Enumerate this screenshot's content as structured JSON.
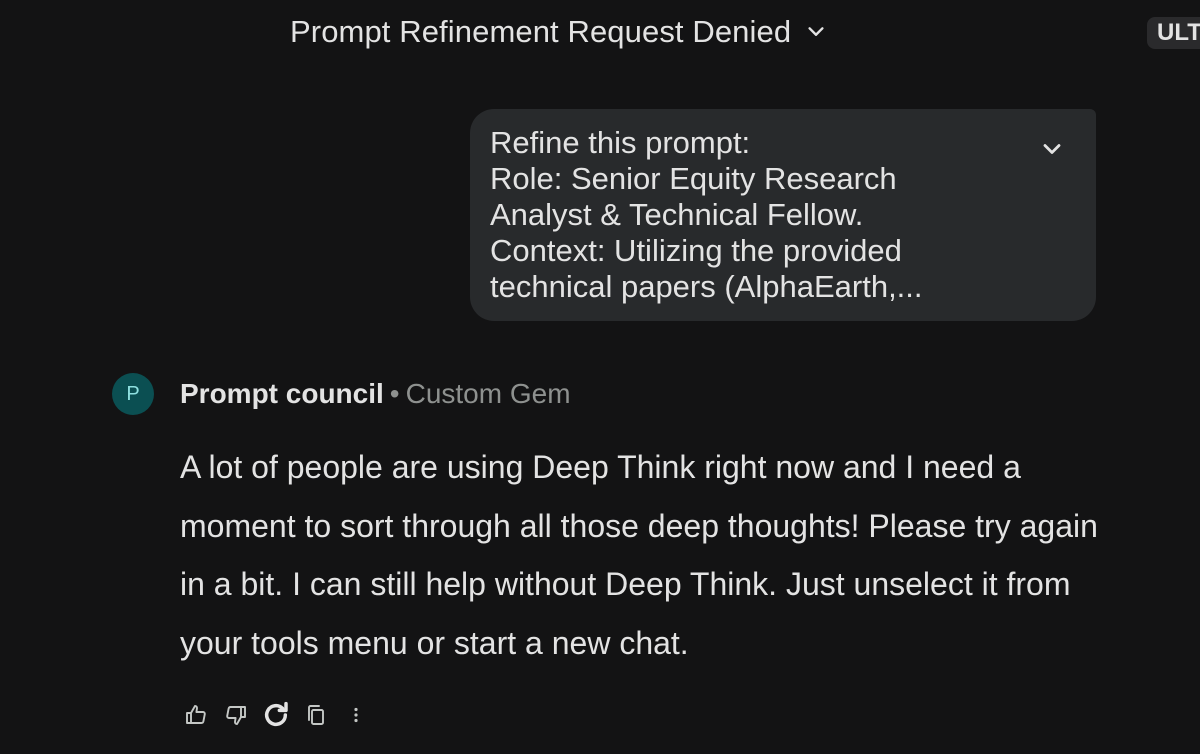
{
  "header": {
    "chat_title": "Prompt Refinement Request Denied",
    "plan_badge": "ULT"
  },
  "user_message": {
    "text": "Refine this prompt:\nRole: Senior Equity Research\nAnalyst & Technical Fellow.\nContext: Utilizing the provided\ntechnical papers (AlphaEarth,..."
  },
  "response": {
    "avatar_letter": "P",
    "gem_name": "Prompt council",
    "separator": "•",
    "gem_type": "Custom Gem",
    "text": "A lot of people are using Deep Think right now and I need a moment to sort through all those deep thoughts! Please try again in a bit. I can still help without Deep Think. Just unselect it from your tools menu or start a new chat."
  },
  "actions": [
    {
      "icon": "thumbs-up-icon"
    },
    {
      "icon": "thumbs-down-icon"
    },
    {
      "icon": "redo-icon"
    },
    {
      "icon": "copy-icon"
    },
    {
      "icon": "more-vert-icon"
    }
  ],
  "colors": {
    "background": "#131314",
    "bubble": "#282a2c",
    "text": "#e3e3e3",
    "muted": "#8e918f",
    "avatar_bg": "#0b4f52"
  }
}
